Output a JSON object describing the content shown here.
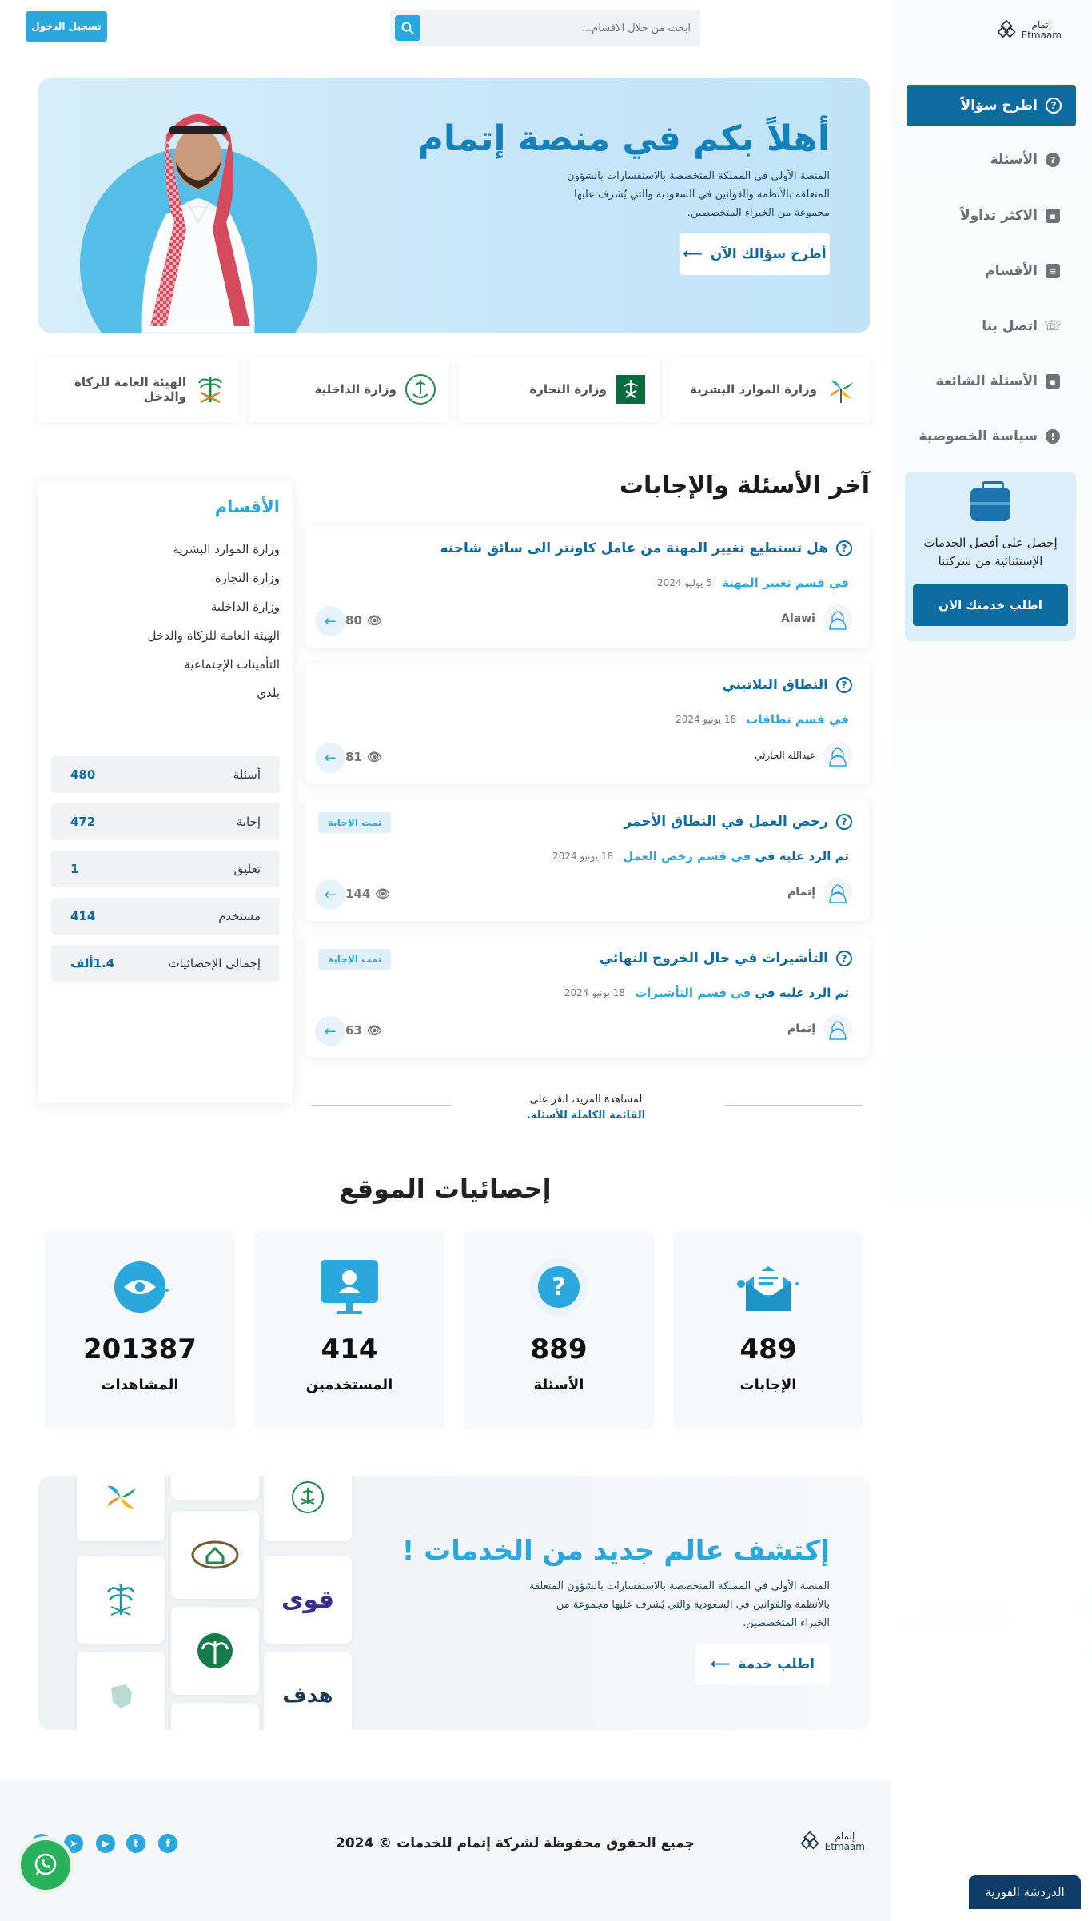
{
  "header": {
    "logo_ar": "إتمام",
    "logo_en": "Etmaam",
    "search_placeholder": "ابحث من خلال الاقسام...",
    "login": "تسجيل الدخول"
  },
  "sidebar": {
    "ask": "اطرح سؤالاً",
    "items": [
      {
        "label": "الأسئلة",
        "icon": "question-icon"
      },
      {
        "label": "الاكثر تداولاً",
        "icon": "chat-icon"
      },
      {
        "label": "الأقسام",
        "icon": "document-icon"
      },
      {
        "label": "اتصل بنا",
        "icon": "phone-icon"
      },
      {
        "label": "الأسئلة الشائعة",
        "icon": "forum-icon"
      },
      {
        "label": "سياسة الخصوصية",
        "icon": "shield-icon"
      }
    ],
    "promo_text": "إحصل على أفضل الخدمات الإستثنائية من شركتنا",
    "promo_button": "اطلب خدمتك الان"
  },
  "hero": {
    "title": "أهلاً بكم في منصة إتمام",
    "text": "المنصة الأولى في المملكة المتخصصة بالاستفسارات بالشؤون المتعلقة بالأنظمة والقوانين في السعودية والتي يُشرف عليها مجموعة من الخبراء المتخصصين.",
    "cta": "أطرح سؤالك الآن"
  },
  "ministries": [
    "وزارة الموارد البشرية",
    "وزارة التجارة",
    "وزارة الداخلية",
    "الهيئة العامة للزكاة والدخل"
  ],
  "questions": {
    "title": "آخر الأسئلة والإجابات",
    "list": [
      {
        "title": "هل تستطيع تغيير المهنة من عامل كاونتر الى سائق شاحنه",
        "prefix": "",
        "category": "في قسم تغيير المهنة",
        "date": "5 يوليو 2024",
        "user": "Alawi",
        "views": "80",
        "badge": ""
      },
      {
        "title": "النطاق البلاتيني",
        "prefix": "",
        "category": "في قسم نطاقات",
        "date": "18 يونيو 2024",
        "user": "عبدالله الحارثي",
        "views": "81",
        "badge": ""
      },
      {
        "title": "رخص العمل في النطاق الأحمر",
        "prefix": "تم الرد عليه في",
        "category": "في قسم رخص العمل",
        "date": "18 يونيو 2024",
        "user": "إتمام",
        "views": "144",
        "badge": "تمت الإجابة"
      },
      {
        "title": "التأشيرات في حال الخروج النهائي",
        "prefix": "تم الرد عليه في",
        "category": "في قسم التأشيرات",
        "date": "18 يونيو 2024",
        "user": "إتمام",
        "views": "63",
        "badge": "تمت الإجابة"
      }
    ],
    "more_text": "لمشاهدة المزيد، انقر على",
    "more_link": "القائمة الكاملة للأسئلة."
  },
  "categories": {
    "title": "الأقسام",
    "items": [
      "وزارة الموارد البشرية",
      "وزارة التجارة",
      "وزارة الداخلية",
      "الهيئة العامة للزكاة والدخل",
      "التأمينات الإجتماعية",
      "بلدي"
    ],
    "stats": [
      {
        "label": "أسئلة",
        "value": "480"
      },
      {
        "label": "إجابة",
        "value": "472"
      },
      {
        "label": "تعليق",
        "value": "1"
      },
      {
        "label": "مستخدم",
        "value": "414"
      },
      {
        "label": "إجمالي الإحصائيات",
        "value": "1.4ألف"
      }
    ]
  },
  "site_stats": {
    "title": "إحصائيات الموقع",
    "items": [
      {
        "label": "الإجابات",
        "value": "489",
        "icon": "envelope-icon"
      },
      {
        "label": "الأسئلة",
        "value": "889",
        "icon": "question-icon"
      },
      {
        "label": "المستخدمين",
        "value": "414",
        "icon": "monitor-user-icon"
      },
      {
        "label": "المشاهدات",
        "value": "201387",
        "icon": "eye-icon"
      }
    ]
  },
  "discover": {
    "title": "إكتشف عالم جديد من الخدمات !",
    "text": "المنصة الأولى في المملكة المتخصصة بالاستفسارات بالشؤون المتعلقة بالأنظمة والقوانين في السعودية والتي يُشرف عليها مجموعة من الخبراء المتخصصين.",
    "cta": "اطلب خدمة",
    "logo_texts": [
      "قوى",
      "هدف"
    ]
  },
  "footer": {
    "copyright": "جميع الحقوق محفوظة لشركة إتمام للخدمات © 2024",
    "social": [
      "facebook-icon",
      "twitter-icon",
      "youtube-icon",
      "telegram-icon",
      "linkedin-icon"
    ]
  },
  "chat_label": "الدردشة الفورية",
  "colors": {
    "primary": "#0e6ba0",
    "accent": "#2aa7dd",
    "whatsapp": "#2ab15c",
    "chat": "#0e3e68"
  }
}
